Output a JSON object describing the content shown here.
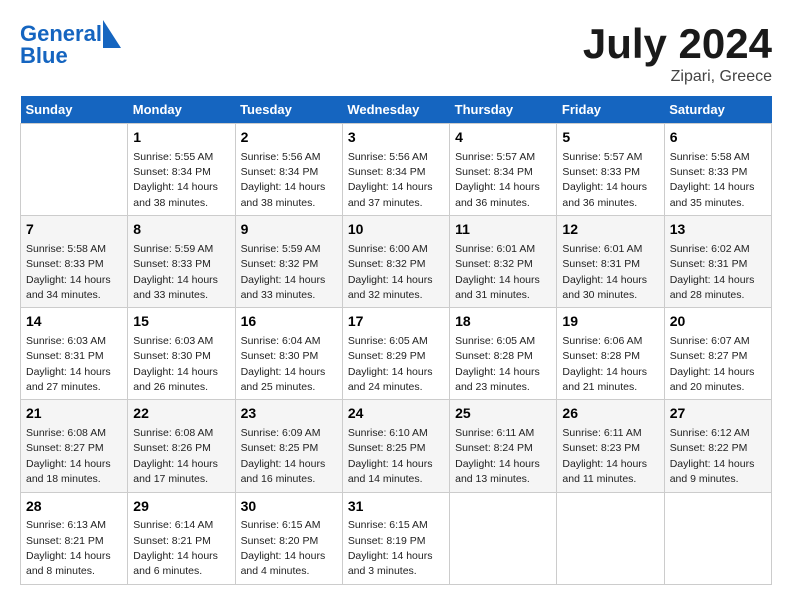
{
  "header": {
    "logo_line1": "General",
    "logo_line2": "Blue",
    "main_title": "July 2024",
    "subtitle": "Zipari, Greece"
  },
  "days_header": [
    "Sunday",
    "Monday",
    "Tuesday",
    "Wednesday",
    "Thursday",
    "Friday",
    "Saturday"
  ],
  "weeks": [
    [
      {
        "day": "",
        "sunrise": "",
        "sunset": "",
        "daylight": ""
      },
      {
        "day": "1",
        "sunrise": "Sunrise: 5:55 AM",
        "sunset": "Sunset: 8:34 PM",
        "daylight": "Daylight: 14 hours and 38 minutes."
      },
      {
        "day": "2",
        "sunrise": "Sunrise: 5:56 AM",
        "sunset": "Sunset: 8:34 PM",
        "daylight": "Daylight: 14 hours and 38 minutes."
      },
      {
        "day": "3",
        "sunrise": "Sunrise: 5:56 AM",
        "sunset": "Sunset: 8:34 PM",
        "daylight": "Daylight: 14 hours and 37 minutes."
      },
      {
        "day": "4",
        "sunrise": "Sunrise: 5:57 AM",
        "sunset": "Sunset: 8:34 PM",
        "daylight": "Daylight: 14 hours and 36 minutes."
      },
      {
        "day": "5",
        "sunrise": "Sunrise: 5:57 AM",
        "sunset": "Sunset: 8:33 PM",
        "daylight": "Daylight: 14 hours and 36 minutes."
      },
      {
        "day": "6",
        "sunrise": "Sunrise: 5:58 AM",
        "sunset": "Sunset: 8:33 PM",
        "daylight": "Daylight: 14 hours and 35 minutes."
      }
    ],
    [
      {
        "day": "7",
        "sunrise": "Sunrise: 5:58 AM",
        "sunset": "Sunset: 8:33 PM",
        "daylight": "Daylight: 14 hours and 34 minutes."
      },
      {
        "day": "8",
        "sunrise": "Sunrise: 5:59 AM",
        "sunset": "Sunset: 8:33 PM",
        "daylight": "Daylight: 14 hours and 33 minutes."
      },
      {
        "day": "9",
        "sunrise": "Sunrise: 5:59 AM",
        "sunset": "Sunset: 8:32 PM",
        "daylight": "Daylight: 14 hours and 33 minutes."
      },
      {
        "day": "10",
        "sunrise": "Sunrise: 6:00 AM",
        "sunset": "Sunset: 8:32 PM",
        "daylight": "Daylight: 14 hours and 32 minutes."
      },
      {
        "day": "11",
        "sunrise": "Sunrise: 6:01 AM",
        "sunset": "Sunset: 8:32 PM",
        "daylight": "Daylight: 14 hours and 31 minutes."
      },
      {
        "day": "12",
        "sunrise": "Sunrise: 6:01 AM",
        "sunset": "Sunset: 8:31 PM",
        "daylight": "Daylight: 14 hours and 30 minutes."
      },
      {
        "day": "13",
        "sunrise": "Sunrise: 6:02 AM",
        "sunset": "Sunset: 8:31 PM",
        "daylight": "Daylight: 14 hours and 28 minutes."
      }
    ],
    [
      {
        "day": "14",
        "sunrise": "Sunrise: 6:03 AM",
        "sunset": "Sunset: 8:31 PM",
        "daylight": "Daylight: 14 hours and 27 minutes."
      },
      {
        "day": "15",
        "sunrise": "Sunrise: 6:03 AM",
        "sunset": "Sunset: 8:30 PM",
        "daylight": "Daylight: 14 hours and 26 minutes."
      },
      {
        "day": "16",
        "sunrise": "Sunrise: 6:04 AM",
        "sunset": "Sunset: 8:30 PM",
        "daylight": "Daylight: 14 hours and 25 minutes."
      },
      {
        "day": "17",
        "sunrise": "Sunrise: 6:05 AM",
        "sunset": "Sunset: 8:29 PM",
        "daylight": "Daylight: 14 hours and 24 minutes."
      },
      {
        "day": "18",
        "sunrise": "Sunrise: 6:05 AM",
        "sunset": "Sunset: 8:28 PM",
        "daylight": "Daylight: 14 hours and 23 minutes."
      },
      {
        "day": "19",
        "sunrise": "Sunrise: 6:06 AM",
        "sunset": "Sunset: 8:28 PM",
        "daylight": "Daylight: 14 hours and 21 minutes."
      },
      {
        "day": "20",
        "sunrise": "Sunrise: 6:07 AM",
        "sunset": "Sunset: 8:27 PM",
        "daylight": "Daylight: 14 hours and 20 minutes."
      }
    ],
    [
      {
        "day": "21",
        "sunrise": "Sunrise: 6:08 AM",
        "sunset": "Sunset: 8:27 PM",
        "daylight": "Daylight: 14 hours and 18 minutes."
      },
      {
        "day": "22",
        "sunrise": "Sunrise: 6:08 AM",
        "sunset": "Sunset: 8:26 PM",
        "daylight": "Daylight: 14 hours and 17 minutes."
      },
      {
        "day": "23",
        "sunrise": "Sunrise: 6:09 AM",
        "sunset": "Sunset: 8:25 PM",
        "daylight": "Daylight: 14 hours and 16 minutes."
      },
      {
        "day": "24",
        "sunrise": "Sunrise: 6:10 AM",
        "sunset": "Sunset: 8:25 PM",
        "daylight": "Daylight: 14 hours and 14 minutes."
      },
      {
        "day": "25",
        "sunrise": "Sunrise: 6:11 AM",
        "sunset": "Sunset: 8:24 PM",
        "daylight": "Daylight: 14 hours and 13 minutes."
      },
      {
        "day": "26",
        "sunrise": "Sunrise: 6:11 AM",
        "sunset": "Sunset: 8:23 PM",
        "daylight": "Daylight: 14 hours and 11 minutes."
      },
      {
        "day": "27",
        "sunrise": "Sunrise: 6:12 AM",
        "sunset": "Sunset: 8:22 PM",
        "daylight": "Daylight: 14 hours and 9 minutes."
      }
    ],
    [
      {
        "day": "28",
        "sunrise": "Sunrise: 6:13 AM",
        "sunset": "Sunset: 8:21 PM",
        "daylight": "Daylight: 14 hours and 8 minutes."
      },
      {
        "day": "29",
        "sunrise": "Sunrise: 6:14 AM",
        "sunset": "Sunset: 8:21 PM",
        "daylight": "Daylight: 14 hours and 6 minutes."
      },
      {
        "day": "30",
        "sunrise": "Sunrise: 6:15 AM",
        "sunset": "Sunset: 8:20 PM",
        "daylight": "Daylight: 14 hours and 4 minutes."
      },
      {
        "day": "31",
        "sunrise": "Sunrise: 6:15 AM",
        "sunset": "Sunset: 8:19 PM",
        "daylight": "Daylight: 14 hours and 3 minutes."
      },
      {
        "day": "",
        "sunrise": "",
        "sunset": "",
        "daylight": ""
      },
      {
        "day": "",
        "sunrise": "",
        "sunset": "",
        "daylight": ""
      },
      {
        "day": "",
        "sunrise": "",
        "sunset": "",
        "daylight": ""
      }
    ]
  ]
}
